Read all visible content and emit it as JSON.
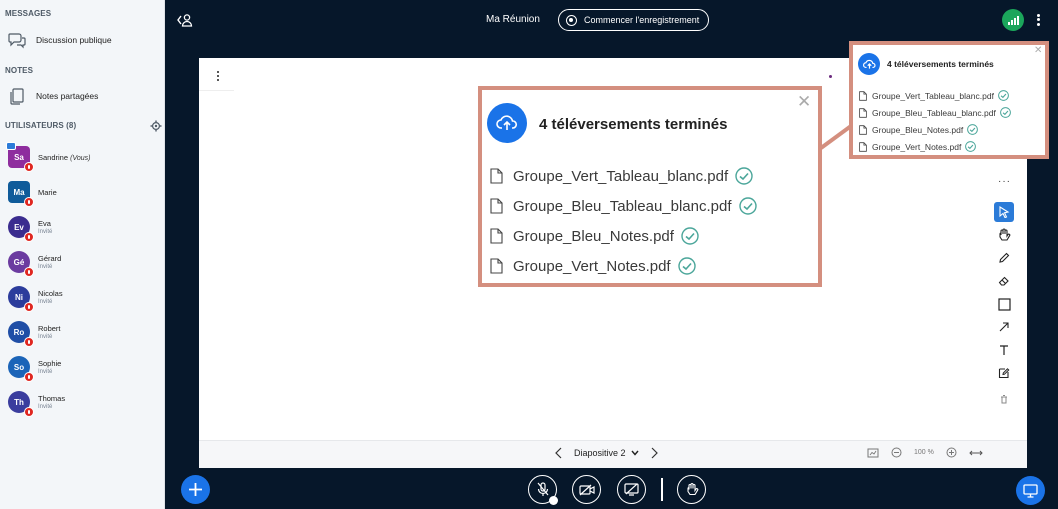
{
  "sidebar": {
    "messages_title": "MESSAGES",
    "public_chat": "Discussion publique",
    "notes_title": "NOTES",
    "shared_notes": "Notes partagées",
    "users_title": "UTILISATEURS (8)",
    "users": [
      {
        "initials": "Sa",
        "name": "Sandrine",
        "tag": "(Vous)",
        "role": "",
        "color": "#8E2D9E"
      },
      {
        "initials": "Ma",
        "name": "Marie",
        "tag": "",
        "role": "",
        "color": "#0F5B9A"
      },
      {
        "initials": "Ev",
        "name": "Eva",
        "tag": "",
        "role": "Invité",
        "color": "#3A2C8F"
      },
      {
        "initials": "Gé",
        "name": "Gérard",
        "tag": "",
        "role": "Invité",
        "color": "#6B3BA0"
      },
      {
        "initials": "Ni",
        "name": "Nicolas",
        "tag": "",
        "role": "Invité",
        "color": "#2B3C9C"
      },
      {
        "initials": "Ro",
        "name": "Robert",
        "tag": "",
        "role": "Invité",
        "color": "#1F4EA6"
      },
      {
        "initials": "So",
        "name": "Sophie",
        "tag": "",
        "role": "Invité",
        "color": "#1B64B8"
      },
      {
        "initials": "Th",
        "name": "Thomas",
        "tag": "",
        "role": "Invité",
        "color": "#3A3D9E"
      }
    ]
  },
  "header": {
    "meeting_title": "Ma Réunion",
    "record_label": "Commencer l'enregistrement"
  },
  "upload_toast": {
    "title": "4 téléversements terminés",
    "files": [
      "Groupe_Vert_Tableau_blanc.pdf",
      "Groupe_Bleu_Tableau_blanc.pdf",
      "Groupe_Bleu_Notes.pdf",
      "Groupe_Vert_Notes.pdf"
    ]
  },
  "presentation": {
    "slide_label": "Diapositive 2",
    "zoom": "100 %"
  },
  "colors": {
    "background": "#06172A",
    "accent": "#1A73E8",
    "highlight_border": "#D48F7F",
    "success": "#1BA65B",
    "danger": "#DF2721"
  },
  "icons": {
    "chat": "chat-bubbles-icon",
    "notes": "notes-icon",
    "settings": "gear-icon",
    "record": "record-icon",
    "connection": "signal-bars-icon",
    "upload": "cloud-upload-icon",
    "file": "file-icon",
    "check": "check-circle-icon"
  }
}
